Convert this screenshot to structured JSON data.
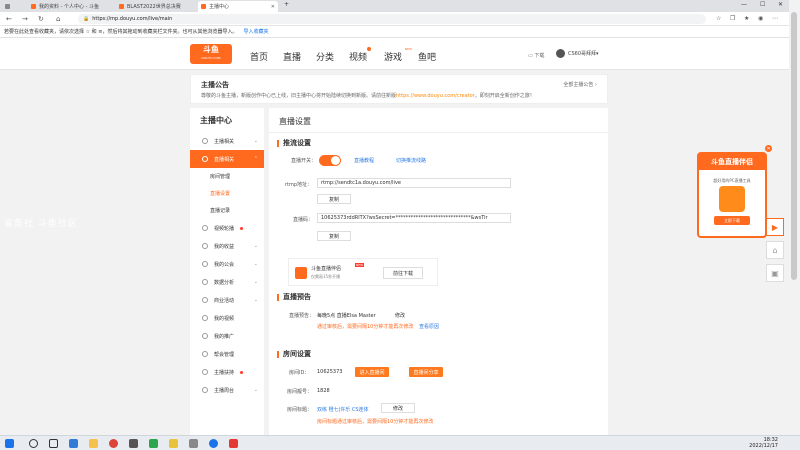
{
  "browser": {
    "tabs": [
      {
        "label": "我的资料 - 个人中心 - 斗鱼",
        "color": "#ff6a1f"
      },
      {
        "label": "BLAST2022世界总决赛",
        "color": "#ff6a1f"
      },
      {
        "label": "主播中心",
        "color": "#ff6a1f"
      }
    ],
    "left_tab_label": "",
    "url": "https://mp.douyu.com/live/main",
    "bookmark_bar": {
      "text": "若要在此处查看收藏夹，请依次选择 ☆ 和 ≡，然后将其拖动到收藏夹栏文件夹。也可从其他浏览器导入。",
      "link": "导入收藏夹"
    }
  },
  "site": {
    "logo_text": "斗鱼",
    "logo_sub": "DOUYU.COM",
    "nav": [
      "首页",
      "直播",
      "分类",
      "视频",
      "游戏",
      "鱼吧"
    ],
    "download": "下载",
    "username": "CS60哥拜拜"
  },
  "notice": {
    "title": "主播公告",
    "text_before": "尊敬的斗鱼主播，新版创作中心已上线，旧主播中心将开始陆续切换到新版。请前往新版",
    "link": "https://www.douyu.com/creator",
    "text_after": "，即刻开启全新创作之旅！",
    "all_label": "全部主播公告"
  },
  "sidebar": {
    "title": "主播中心",
    "items": [
      {
        "label": "主播相关",
        "active": false,
        "dot": false
      },
      {
        "label": "直播相关",
        "active": true,
        "dot": false
      },
      {
        "label": "视频轮播",
        "active": false,
        "dot": true
      },
      {
        "label": "我的收益",
        "active": false,
        "dot": false
      },
      {
        "label": "我的公会",
        "active": false,
        "dot": false
      },
      {
        "label": "数据分析",
        "active": false,
        "dot": false
      },
      {
        "label": "商业活动",
        "active": false,
        "dot": false
      },
      {
        "label": "我的视频",
        "active": false,
        "dot": false
      },
      {
        "label": "我的推广",
        "active": false,
        "dot": false
      },
      {
        "label": "帮会管理",
        "active": false,
        "dot": false
      },
      {
        "label": "主播扶持",
        "active": false,
        "dot": true
      },
      {
        "label": "主播周台",
        "active": false,
        "dot": false
      }
    ],
    "subitems": [
      "房间管理",
      "直播设置",
      "直播记录"
    ]
  },
  "main": {
    "page_title": "直播设置",
    "push": {
      "section": "推流设置",
      "switch_label": "直播开关：",
      "tutorial": "直播教程",
      "switch_line": "切换推流线路",
      "rtmp_label": "rtmp地址：",
      "rtmp_value": "rtmp://sendtc1a.douyu.com/live",
      "code_label": "直播码：",
      "code_value": "10625373rddRlTX?wsSecret=******************************&wsTir",
      "copy": "复制",
      "helper_name": "斗鱼直播伴侣",
      "helper_badge": "NEW",
      "helper_desc": "仅需敲15秒开播",
      "helper_btn": "前往下载"
    },
    "preview": {
      "section": "直播预告",
      "label": "直播预告：",
      "value": "每晚5点 直播Elsa Master",
      "edit": "修改",
      "tip": "通过审核后，需要间隔10分钟才能再次修改",
      "view_reason": "查看原因"
    },
    "room": {
      "section": "房间设置",
      "id_label": "房间ID：",
      "id_value": "10625373",
      "enter_btn": "进入直播间",
      "share_btn": "直播间分享",
      "num_label": "房间靓号：",
      "num_value": "1828",
      "title_label": "房间标题：",
      "title_value": "双练 橙七|许乐 CS连体",
      "edit": "修改",
      "tip": "房间标题通过审核后，需要间隔10分钟才能再次修改"
    }
  },
  "ad": {
    "title": "斗鱼直播伴侣",
    "desc": "超好用的PC直播工具",
    "button": "立即下载"
  },
  "watermark": "鲨鱼社 斗鱼社区",
  "taskbar": {
    "time": "18:32",
    "date": "2022/12/17"
  }
}
